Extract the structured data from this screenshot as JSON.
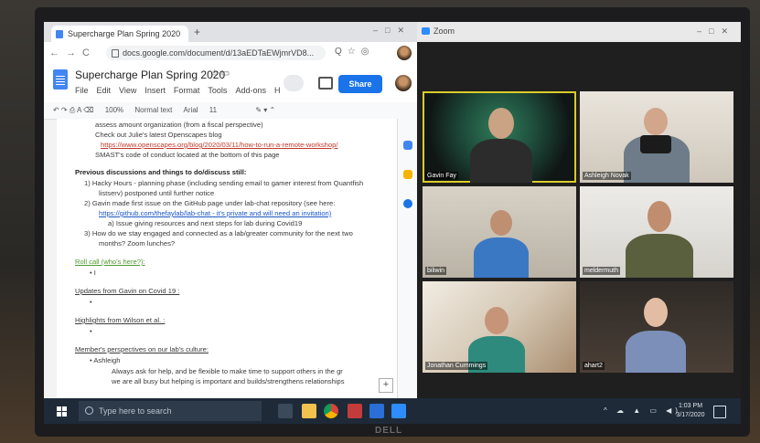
{
  "docs": {
    "tab_title": "Supercharge Plan Spring 2020",
    "url": "docs.google.com/document/d/13aEDTaEWjmrVD8...",
    "title": "Supercharge Plan Spring 2020",
    "menu": [
      "File",
      "Edit",
      "View",
      "Insert",
      "Format",
      "Tools",
      "Add-ons",
      "H"
    ],
    "share_label": "Share",
    "toolbar": {
      "zoom": "100%",
      "style": "Normal text",
      "font": "Arial",
      "size": "11"
    },
    "lines": [
      "assess amount organization (from a fiscal perspective)",
      "Check out Julie's latest Openscapes blog",
      "https://www.openscapes.org/blog/2020/03/11/how-to-run-a-remote-workshop/",
      "SMAST's code of conduct located at the bottom of this page",
      "Previous discussions and things to do/discuss still:",
      "1)  Hacky Hours - planning phase (including sending email to gamer interest from Quantfish",
      "listserv) postponed until further notice",
      "2)  Gavin made first issue on the GitHub page under lab-chat repository (see here:",
      "https://github.com/thefaylab/lab-chat - it's private and will need an invitation)",
      "a)  Issue giving resources and next steps for lab during Covid19",
      "3)  How do we stay engaged and connected as a lab/greater community for the next two",
      "months? Zoom lunches?",
      "Roll call (who's here?):",
      "•  I",
      "Updates from Gavin on Covid 19 :",
      "•",
      "Highlights from Wilson et al. :",
      "•",
      "Member's perspectives on our lab's culture:",
      "•  Ashleigh",
      "Always ask for help, and be flexible to make time to support others in the gr",
      "we are all busy but helping is important and builds/strengthens relationships"
    ]
  },
  "zoom": {
    "window_title": "Zoom",
    "participants": [
      "Gavin Fay",
      "Ashleigh Novak",
      "biliwin",
      "meldermuth",
      "Jonathan Cummings",
      "ahart2"
    ]
  },
  "taskbar": {
    "search_placeholder": "Type here to search",
    "time": "1:03 PM",
    "date": "3/17/2020"
  },
  "colors": {
    "share": "#1a73e8",
    "active_speaker": "#d9cc2a",
    "taskbar": "#1e2a38"
  }
}
